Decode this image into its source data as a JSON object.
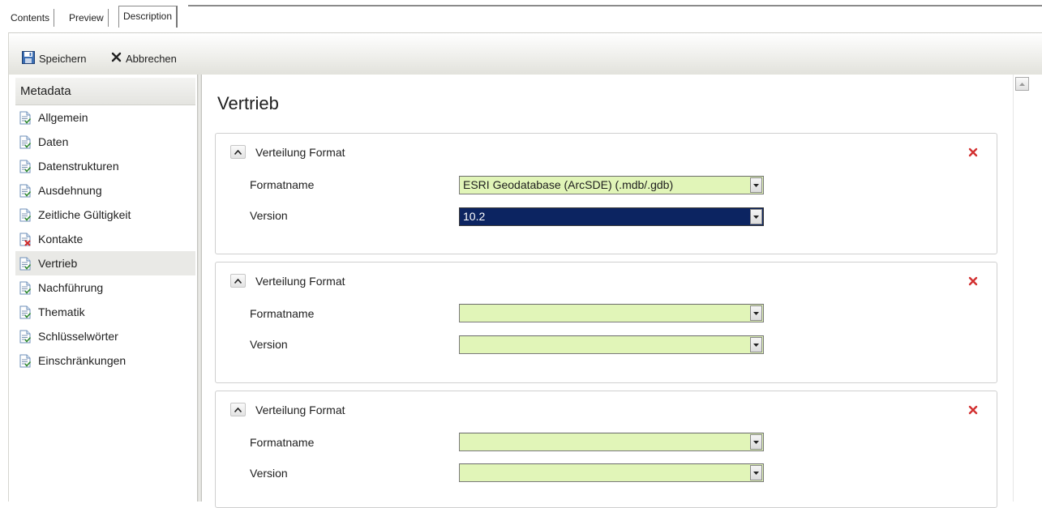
{
  "tabs": [
    {
      "label": "Contents",
      "active": false
    },
    {
      "label": "Preview",
      "active": false
    },
    {
      "label": "Description",
      "active": true
    }
  ],
  "toolbar": {
    "save_label": "Speichern",
    "cancel_label": "Abbrechen"
  },
  "sidebar": {
    "header": "Metadata",
    "items": [
      {
        "label": "Allgemein",
        "icon": "document-check-icon"
      },
      {
        "label": "Daten",
        "icon": "document-check-icon"
      },
      {
        "label": "Datenstrukturen",
        "icon": "document-check-icon"
      },
      {
        "label": "Ausdehnung",
        "icon": "document-check-icon"
      },
      {
        "label": "Zeitliche Gültigkeit",
        "icon": "document-check-icon"
      },
      {
        "label": "Kontakte",
        "icon": "document-error-icon"
      },
      {
        "label": "Vertrieb",
        "icon": "document-check-icon",
        "active": true
      },
      {
        "label": "Nachführung",
        "icon": "document-check-icon"
      },
      {
        "label": "Thematik",
        "icon": "document-check-icon"
      },
      {
        "label": "Schlüsselwörter",
        "icon": "document-check-icon"
      },
      {
        "label": "Einschränkungen",
        "icon": "document-check-icon"
      }
    ]
  },
  "main": {
    "title": "Vertrieb",
    "sections": [
      {
        "title": "Verteilung Format",
        "format_label": "Formatname",
        "format_value": "ESRI Geodatabase (ArcSDE) (.mdb/.gdb)",
        "version_label": "Version",
        "version_value": "10.2"
      },
      {
        "title": "Verteilung Format",
        "format_label": "Formatname",
        "format_value": "",
        "version_label": "Version",
        "version_value": ""
      },
      {
        "title": "Verteilung Format",
        "format_label": "Formatname",
        "format_value": "",
        "version_label": "Version",
        "version_value": ""
      }
    ]
  },
  "colors": {
    "field_fill": "#e1f5b8",
    "selected_fill": "#0c2461",
    "remove_icon": "#d23030"
  }
}
